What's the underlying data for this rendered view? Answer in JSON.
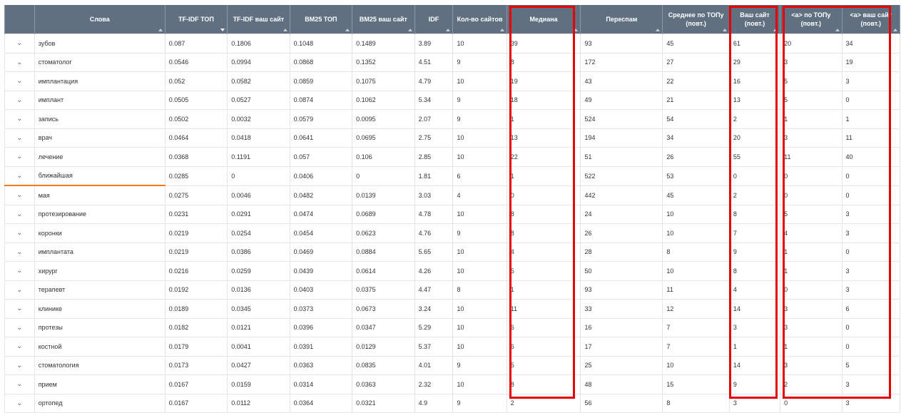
{
  "columns": [
    {
      "key": "expand",
      "label": ""
    },
    {
      "key": "word",
      "label": "Слова"
    },
    {
      "key": "tfidf_top",
      "label": "TF-IDF ТОП"
    },
    {
      "key": "tfidf_site",
      "label": "TF-IDF ваш сайт"
    },
    {
      "key": "bm25_top",
      "label": "BM25 ТОП"
    },
    {
      "key": "bm25_site",
      "label": "BM25 ваш сайт"
    },
    {
      "key": "idf",
      "label": "IDF"
    },
    {
      "key": "sites",
      "label": "Кол-во сайтов"
    },
    {
      "key": "median",
      "label": "Медиана"
    },
    {
      "key": "spam",
      "label": "Переспам"
    },
    {
      "key": "avg_top",
      "label": "Среднее по ТОПу (повт.)"
    },
    {
      "key": "your_site",
      "label": "Ваш сайт (повт.)"
    },
    {
      "key": "a_top",
      "label": "<a> по ТОПу (повт.)"
    },
    {
      "key": "a_site",
      "label": "<a> ваш сайт (повт.)"
    }
  ],
  "expand_icon": "⌄",
  "rows": [
    [
      "зубов",
      "0.087",
      "0.1806",
      "0.1048",
      "0.1489",
      "3.89",
      "10",
      "39",
      "93",
      "45",
      "61",
      "20",
      "34"
    ],
    [
      "стоматолог",
      "0.0546",
      "0.0994",
      "0.0868",
      "0.1352",
      "4.51",
      "9",
      "8",
      "172",
      "27",
      "29",
      "3",
      "19"
    ],
    [
      "имплантация",
      "0.052",
      "0.0582",
      "0.0859",
      "0.1075",
      "4.79",
      "10",
      "19",
      "43",
      "22",
      "16",
      "5",
      "3"
    ],
    [
      "имплант",
      "0.0505",
      "0.0527",
      "0.0874",
      "0.1062",
      "5.34",
      "9",
      "18",
      "49",
      "21",
      "13",
      "5",
      "0"
    ],
    [
      "запись",
      "0.0502",
      "0.0032",
      "0.0579",
      "0.0095",
      "2.07",
      "9",
      "1",
      "524",
      "54",
      "2",
      "1",
      "1"
    ],
    [
      "врач",
      "0.0464",
      "0.0418",
      "0.0641",
      "0.0695",
      "2.75",
      "10",
      "13",
      "194",
      "34",
      "20",
      "3",
      "11"
    ],
    [
      "лечение",
      "0.0368",
      "0.1191",
      "0.057",
      "0.106",
      "2.85",
      "10",
      "22",
      "51",
      "26",
      "55",
      "11",
      "40"
    ],
    [
      "ближайшая",
      "0.0285",
      "0",
      "0.0406",
      "0",
      "1.81",
      "6",
      "1",
      "522",
      "53",
      "0",
      "0",
      "0"
    ],
    [
      "мая",
      "0.0275",
      "0.0046",
      "0.0482",
      "0.0139",
      "3.03",
      "4",
      "0",
      "442",
      "45",
      "2",
      "0",
      "0"
    ],
    [
      "протезирование",
      "0.0231",
      "0.0291",
      "0.0474",
      "0.0689",
      "4.78",
      "10",
      "8",
      "24",
      "10",
      "8",
      "5",
      "3"
    ],
    [
      "коронки",
      "0.0219",
      "0.0254",
      "0.0454",
      "0.0623",
      "4.76",
      "9",
      "8",
      "26",
      "10",
      "7",
      "4",
      "3"
    ],
    [
      "имплантата",
      "0.0219",
      "0.0386",
      "0.0469",
      "0.0884",
      "5.65",
      "10",
      "4",
      "28",
      "8",
      "9",
      "1",
      "0"
    ],
    [
      "хирург",
      "0.0216",
      "0.0259",
      "0.0439",
      "0.0614",
      "4.26",
      "10",
      "5",
      "50",
      "10",
      "8",
      "1",
      "3"
    ],
    [
      "терапевт",
      "0.0192",
      "0.0136",
      "0.0403",
      "0.0375",
      "4.47",
      "8",
      "1",
      "93",
      "11",
      "4",
      "0",
      "3"
    ],
    [
      "клинике",
      "0.0189",
      "0.0345",
      "0.0373",
      "0.0673",
      "3.24",
      "10",
      "11",
      "33",
      "12",
      "14",
      "3",
      "6"
    ],
    [
      "протезы",
      "0.0182",
      "0.0121",
      "0.0396",
      "0.0347",
      "5.29",
      "10",
      "6",
      "16",
      "7",
      "3",
      "3",
      "0"
    ],
    [
      "костной",
      "0.0179",
      "0.0041",
      "0.0391",
      "0.0129",
      "5.37",
      "10",
      "6",
      "17",
      "7",
      "1",
      "1",
      "0"
    ],
    [
      "стоматология",
      "0.0173",
      "0.0427",
      "0.0363",
      "0.0835",
      "4.01",
      "9",
      "5",
      "25",
      "10",
      "14",
      "3",
      "5"
    ],
    [
      "прием",
      "0.0167",
      "0.0159",
      "0.0314",
      "0.0363",
      "2.32",
      "10",
      "8",
      "48",
      "15",
      "9",
      "2",
      "3"
    ],
    [
      "ортопед",
      "0.0167",
      "0.0112",
      "0.0364",
      "0.0321",
      "4.9",
      "9",
      "2",
      "56",
      "8",
      "3",
      "0",
      "3"
    ]
  ],
  "selected_row": 7,
  "highlight_color": "#e60000",
  "accent_color": "#f07a1e",
  "header_color": "#607080"
}
